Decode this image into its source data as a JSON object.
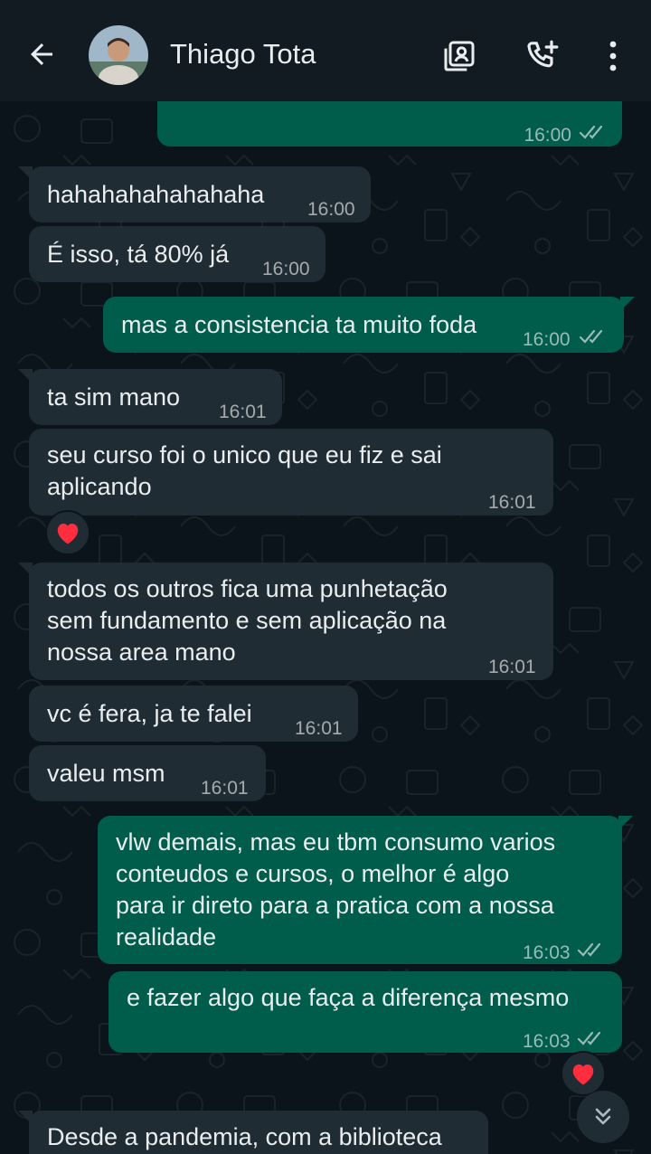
{
  "header": {
    "contact_name": "Thiago Tota"
  },
  "icons": {
    "back": "arrow-left",
    "video_call": "contact-card",
    "add_call": "phone-plus",
    "menu": "more-vertical",
    "scroll_down": "double-chevron-down",
    "reaction": "red-heart"
  },
  "colors": {
    "incoming_bubble": "#202c33",
    "outgoing_bubble": "#005c4b",
    "background": "#0b141a",
    "header": "#111b21"
  },
  "messages": [
    {
      "direction": "out",
      "text": "",
      "time": "16:00",
      "read": true
    },
    {
      "direction": "in",
      "text": "hahahahahahahaha",
      "time": "16:00"
    },
    {
      "direction": "in",
      "text": "É isso, tá 80% já",
      "time": "16:00"
    },
    {
      "direction": "out",
      "text": "mas a consistencia ta muito foda",
      "time": "16:00",
      "read": true
    },
    {
      "direction": "in",
      "text": "ta sim mano",
      "time": "16:01"
    },
    {
      "direction": "in",
      "lines": [
        "seu curso foi o unico que eu fiz e sai",
        "aplicando"
      ],
      "time": "16:01",
      "reaction": "❤"
    },
    {
      "direction": "in",
      "lines": [
        "todos os outros fica uma punhetação",
        "sem fundamento e sem aplicação na",
        "nossa area mano"
      ],
      "time": "16:01"
    },
    {
      "direction": "in",
      "text": "vc é fera, ja te falei",
      "time": "16:01"
    },
    {
      "direction": "in",
      "text": "valeu msm",
      "time": "16:01"
    },
    {
      "direction": "out",
      "lines": [
        "vlw demais, mas eu tbm consumo varios",
        "conteudos e cursos, o melhor é algo",
        "para ir direto para a pratica com a nossa",
        "realidade"
      ],
      "time": "16:03",
      "read": true
    },
    {
      "direction": "out",
      "text": "e fazer algo que faça a diferença mesmo",
      "time": "16:03",
      "read": true,
      "reaction": "❤"
    },
    {
      "direction": "in",
      "text": "Desde a pandemia, com a biblioteca",
      "time": ""
    }
  ]
}
